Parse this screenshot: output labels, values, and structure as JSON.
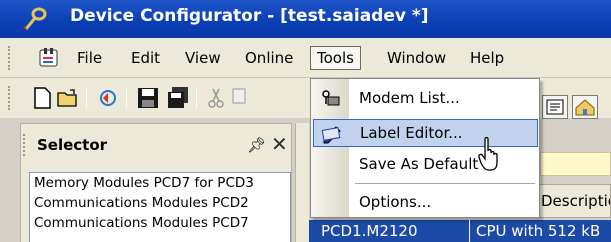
{
  "window": {
    "title": "Device Configurator - [test.saiadev *]"
  },
  "menubar": {
    "items": [
      "File",
      "Edit",
      "View",
      "Online",
      "Tools",
      "Window",
      "Help"
    ],
    "active": "Tools"
  },
  "tools_menu": {
    "items": [
      {
        "label": "Modem List...",
        "icon": "modem-icon"
      },
      {
        "label": "Label Editor...",
        "icon": "label-editor-icon",
        "highlighted": true
      },
      {
        "label": "Save As Default",
        "icon": null
      },
      {
        "label": "Options...",
        "icon": null
      }
    ]
  },
  "selector": {
    "title": "Selector",
    "items": [
      "Memory Modules PCD7 for PCD3",
      "Communications Modules PCD2",
      "Communications Modules PCD7"
    ]
  },
  "main": {
    "column_header": "Description",
    "row": {
      "id": "PCD1.M2120",
      "description": "CPU with 512 kB"
    }
  },
  "colors": {
    "titlebar": "#0a3fb4",
    "highlight": "#c1d2ee",
    "selection": "#1d4aa6"
  }
}
